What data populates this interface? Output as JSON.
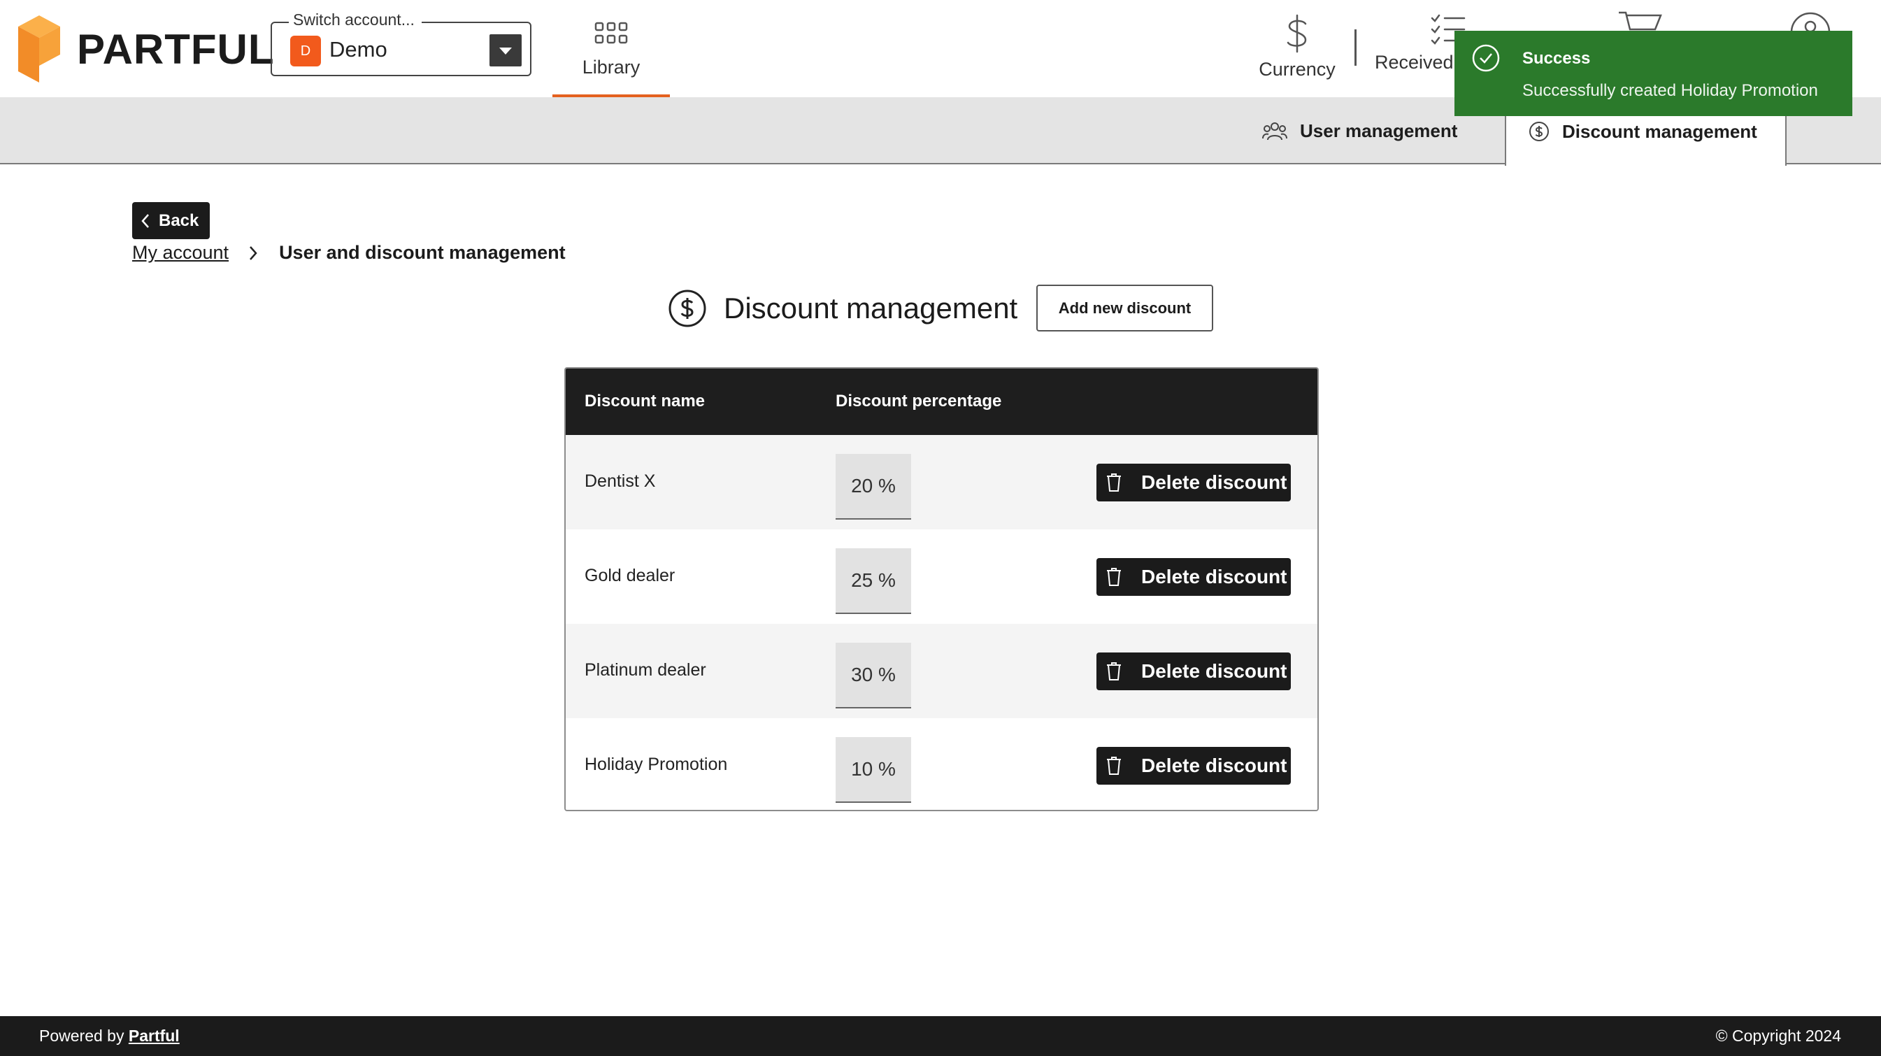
{
  "brand": {
    "name": "PARTFUL",
    "color": "#f28c28"
  },
  "account": {
    "legend": "Switch account...",
    "avatar_initial": "D",
    "name": "Demo"
  },
  "nav": {
    "library": "Library",
    "currency": "Currency",
    "received": "Received",
    "trailing_label_fragment": "t"
  },
  "subnav": {
    "user_management": "User management",
    "discount_management": "Discount management"
  },
  "page": {
    "back_label": "Back",
    "breadcrumb": {
      "parent": "My account",
      "current": "User and discount management"
    },
    "title": "Discount management",
    "add_button": "Add new discount"
  },
  "table": {
    "headers": {
      "name": "Discount name",
      "percentage": "Discount percentage"
    },
    "delete_label": "Delete discount",
    "rows": [
      {
        "name": "Dentist X",
        "percentage": "20 %"
      },
      {
        "name": "Gold dealer",
        "percentage": "25 %"
      },
      {
        "name": "Platinum dealer",
        "percentage": "30 %"
      },
      {
        "name": "Holiday Promotion",
        "percentage": "10 %"
      }
    ]
  },
  "toast": {
    "title": "Success",
    "message": "Successfully created Holiday Promotion",
    "color": "#2b7a2b"
  },
  "footer": {
    "powered_prefix": "Powered by",
    "powered_link": "Partful",
    "copyright": "© Copyright 2024"
  },
  "colors": {
    "accent": "#e4611f",
    "dark": "#1b1b1b",
    "avatar": "#f25a1c"
  }
}
